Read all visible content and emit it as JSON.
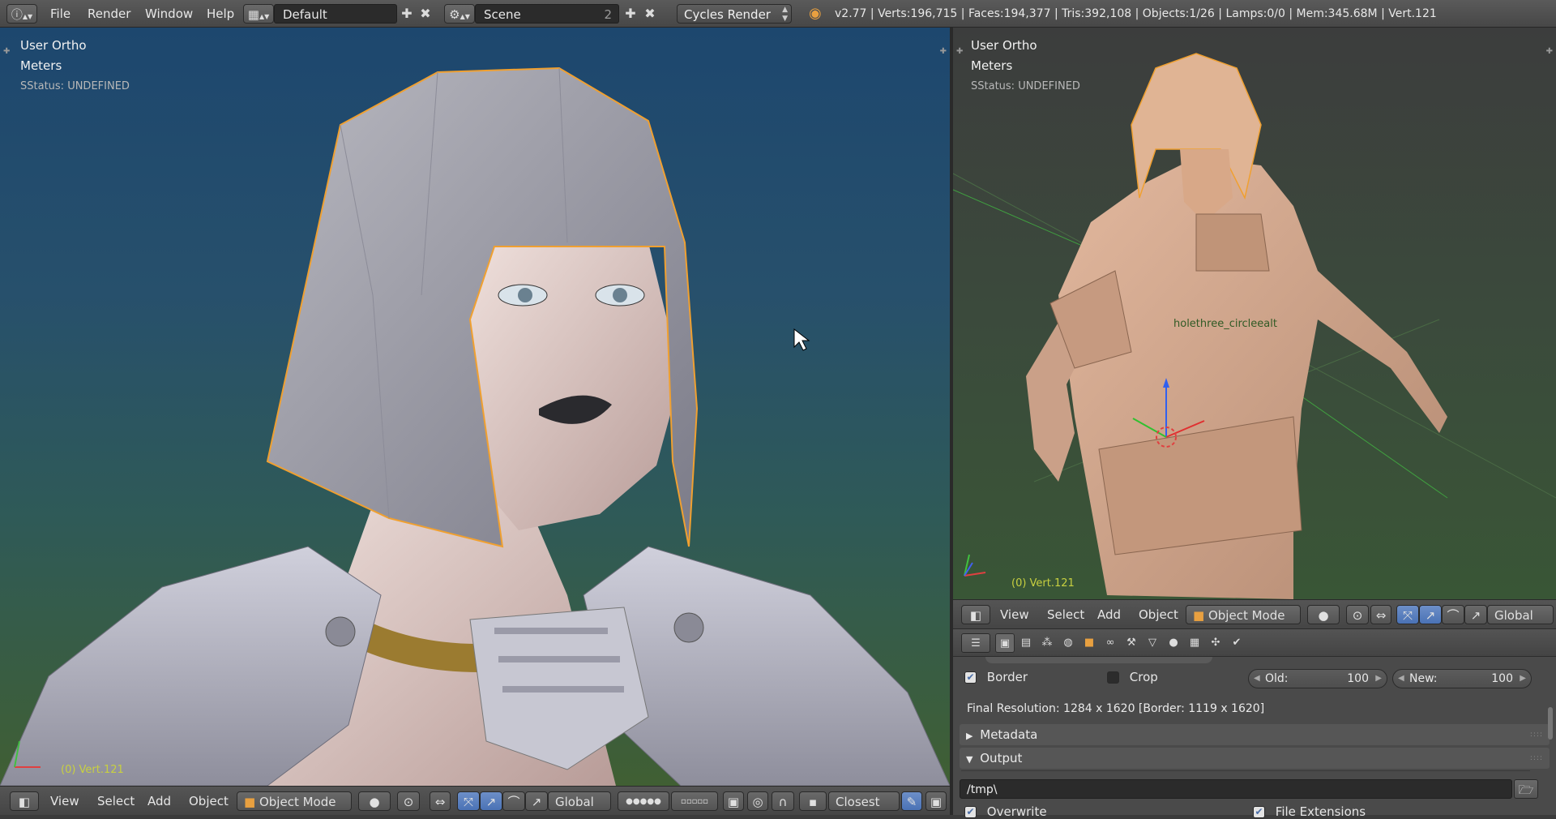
{
  "topbar": {
    "menus": [
      "File",
      "Render",
      "Window",
      "Help"
    ],
    "layout": "Default",
    "scene": "Scene",
    "scene_users": "2",
    "render_engine": "Cycles Render",
    "stats": "v2.77 | Verts:196,715 | Faces:194,377 | Tris:392,108 | Objects:1/26 | Lamps:0/0 | Mem:345.68M | Vert.121"
  },
  "viewport_left": {
    "view_name": "User Ortho",
    "units": "Meters",
    "status": "SStatus: UNDEFINED",
    "object_label": "(0) Vert.121"
  },
  "viewport_right": {
    "view_name": "User Ortho",
    "units": "Meters",
    "status": "SStatus: UNDEFINED",
    "object_label": "(0) Vert.121",
    "scene_label": "holethree_circleealt"
  },
  "header_left": {
    "menus": [
      "View",
      "Select",
      "Add",
      "Object"
    ],
    "mode": "Object Mode",
    "orientation": "Global",
    "snap_target": "Closest"
  },
  "header_right": {
    "menus": [
      "View",
      "Select",
      "Add",
      "Object"
    ],
    "mode": "Object Mode",
    "orientation": "Global"
  },
  "properties": {
    "border_label": "Border",
    "border_checked": true,
    "crop_label": "Crop",
    "crop_checked": false,
    "old_label": "Old:",
    "old_value": "100",
    "new_label": "New:",
    "new_value": "100",
    "final_resolution": "Final Resolution: 1284 x 1620 [Border: 1119 x 1620]",
    "section_metadata": "Metadata",
    "section_output": "Output",
    "output_path": "/tmp\\",
    "overwrite_label": "Overwrite",
    "overwrite_checked": true,
    "file_extensions_label": "File Extensions",
    "file_extensions_checked": true
  },
  "colors": {
    "accent_blue": "#4a72b5",
    "selection_outline": "#f0a030",
    "viewport_top": "#1d476e",
    "viewport_bottom": "#405f33"
  },
  "icons": [
    "info-icon",
    "layout-icon",
    "scene-icon",
    "blender-logo-icon",
    "cursor-arrow-icon",
    "cube-icon",
    "sphere-shading-icon",
    "manipulator-icon",
    "folder-icon"
  ]
}
